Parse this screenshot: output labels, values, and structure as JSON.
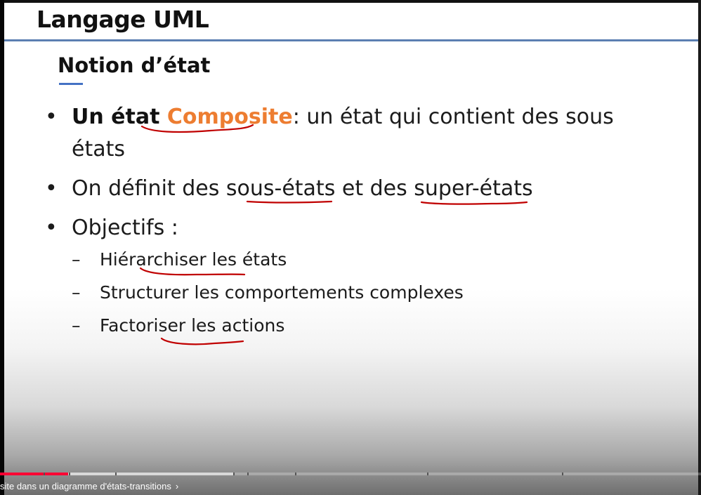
{
  "slide": {
    "title": "Langage UML",
    "subtitle": "Notion d’état",
    "bullets": [
      {
        "strong": "Un état ",
        "accent": "Composite",
        "rest": ": un état qui contient des sous états"
      },
      {
        "text": "On définit des sous-états et des super-états"
      },
      {
        "text": "Objectifs :",
        "subitems": [
          "Hiérarchiser les états",
          "Structurer les comportements complexes",
          "Factoriser les actions"
        ]
      }
    ],
    "bullet_glyph": "•",
    "dash_glyph": "–",
    "colors": {
      "accent": "#ed7d31",
      "rule": "#5b7fb1",
      "ink": "#c00000"
    }
  },
  "player": {
    "chapter_title": "site dans un diagramme d'états-transitions",
    "chevron": "›",
    "progress_fraction": 0.097,
    "buffered_fraction": 0.335
  }
}
